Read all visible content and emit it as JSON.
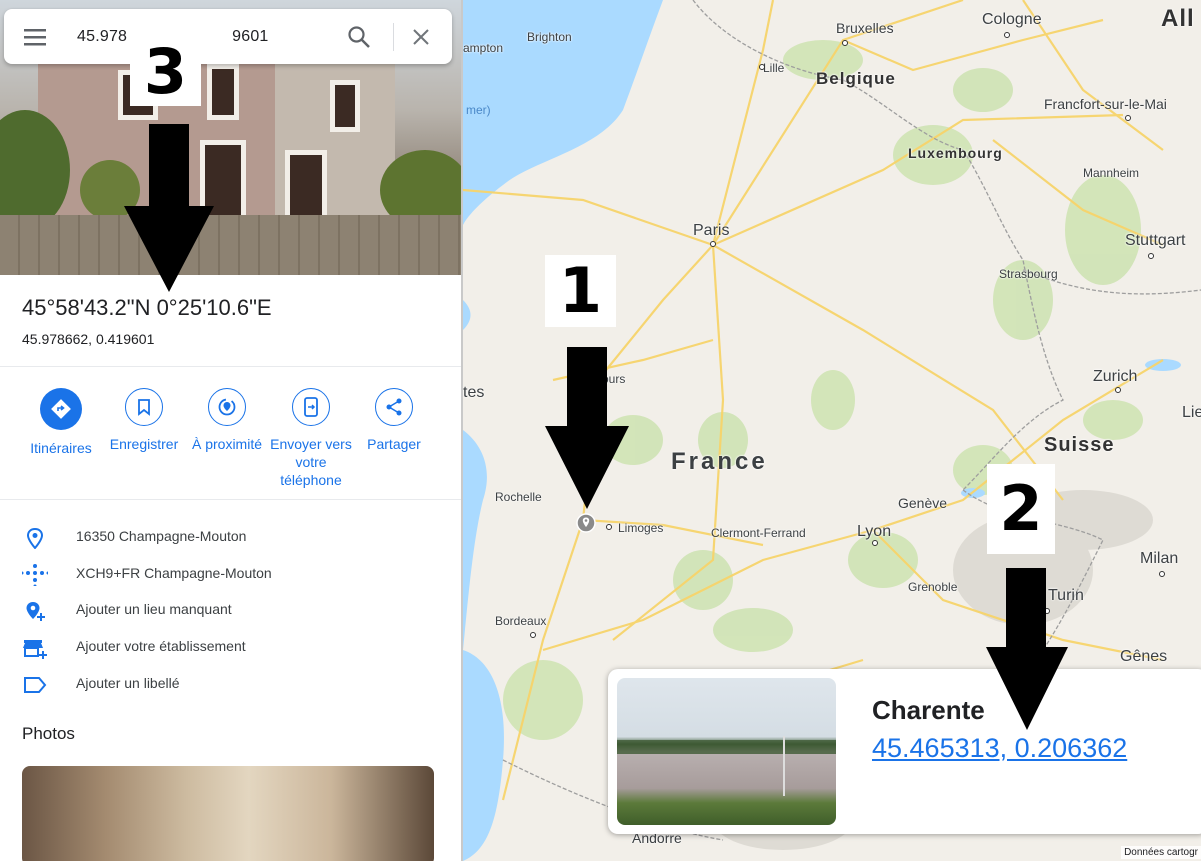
{
  "search": {
    "query": "45.978",
    "query_tail": "9601"
  },
  "place": {
    "coords_dms": "45°58'43.2\"N 0°25'10.6\"E",
    "coords_decimal": "45.978662, 0.419601"
  },
  "actions": [
    {
      "label": "Itinéraires",
      "icon": "directions-icon"
    },
    {
      "label": "Enregistrer",
      "icon": "bookmark-icon"
    },
    {
      "label": "À proximité",
      "icon": "nearby-icon"
    },
    {
      "label_lines": [
        "Envoyer vers",
        "votre",
        "téléphone"
      ],
      "icon": "send-to-phone-icon"
    },
    {
      "label": "Partager",
      "icon": "share-icon"
    }
  ],
  "info": [
    {
      "text": "16350 Champagne-Mouton",
      "icon": "location-pin-icon"
    },
    {
      "text": "XCH9+FR Champagne-Mouton",
      "icon": "plus-code-icon"
    },
    {
      "text": "Ajouter un lieu manquant",
      "icon": "add-place-icon"
    },
    {
      "text": "Ajouter votre établissement",
      "icon": "add-business-icon"
    },
    {
      "text": "Ajouter un libellé",
      "icon": "label-icon"
    }
  ],
  "photos_title": "Photos",
  "map": {
    "labels": {
      "bruxelles": "Bruxelles",
      "cologne": "Cologne",
      "all": "All",
      "brighton": "Brighton",
      "ampton": "ampton",
      "lille": "Lille",
      "belgique": "Belgique",
      "mer": "mer)",
      "francfort": "Francfort-sur-le-Mai",
      "luxembourg": "Luxembourg",
      "mannheim": "Mannheim",
      "paris": "Paris",
      "stuttgart": "Stuttgart",
      "strasbourg": "Strasbourg",
      "tes": "tes",
      "tours": "ours",
      "zurich": "Zurich",
      "lie": "Lie",
      "suisse": "Suisse",
      "france": "France",
      "rochelle": "Rochelle",
      "geneve": "Genève",
      "limoges": "Limoges",
      "clermont": "Clermont-Ferrand",
      "lyon": "Lyon",
      "milan": "Milan",
      "grenoble": "Grenoble",
      "turin": "Turin",
      "bordeaux": "Bordeaux",
      "genes": "Gênes",
      "andorre": "Andorre"
    },
    "attribution": "Données cartogr"
  },
  "card": {
    "title": "Charente",
    "link": "45.465313, 0.206362"
  },
  "annotations": {
    "a1": "1",
    "a2": "2",
    "a3": "3"
  },
  "colors": {
    "accent": "#1a73e8",
    "map_bg": "#f2efe9",
    "road": "#f7d46b",
    "water": "#aadaff",
    "green": "#cfe3b4"
  }
}
